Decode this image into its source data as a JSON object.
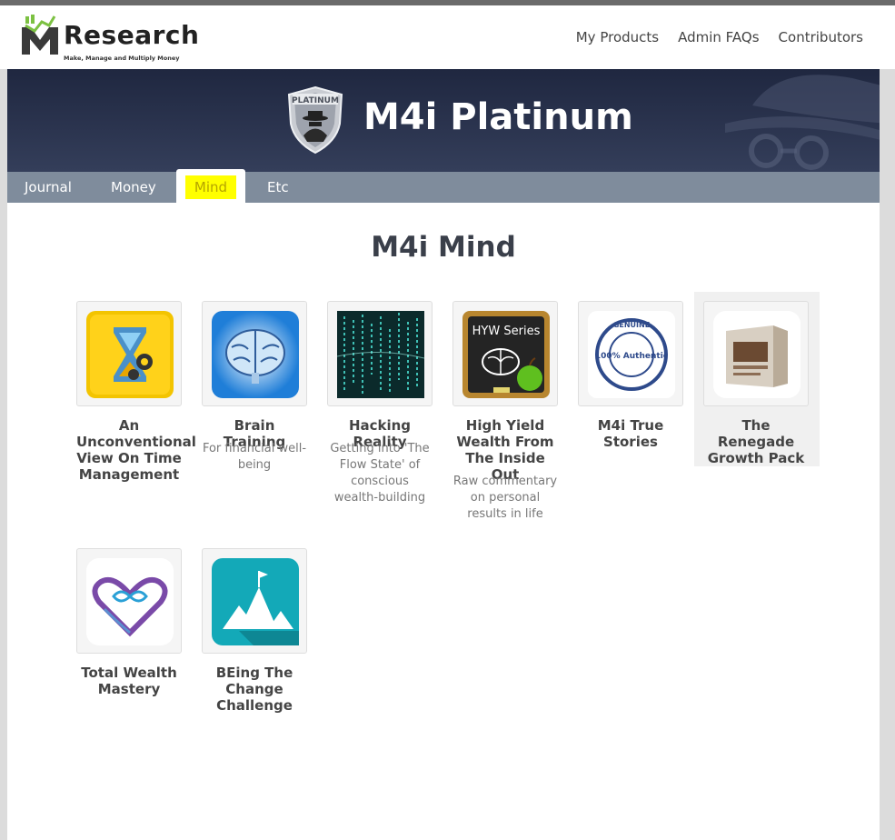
{
  "brand": {
    "name": "Research",
    "tagline": "Make, Manage and Multiply Money"
  },
  "topnav": [
    "My Products",
    "Admin FAQs",
    "Contributors"
  ],
  "banner": {
    "title": "M4i Platinum",
    "badge": "PLATINUM"
  },
  "tabs": [
    "Journal",
    "Money",
    "Mind",
    "Etc"
  ],
  "active_tab": "Mind",
  "section": {
    "title": "M4i Mind"
  },
  "products": [
    {
      "name": "An Unconventional View On Time Management",
      "desc": "",
      "icon": "hourglass-icon"
    },
    {
      "name": "Brain Training",
      "desc": "For financial well-being",
      "icon": "brain-icon"
    },
    {
      "name": "Hacking Reality",
      "desc": "Getting into 'The Flow State' of conscious wealth-building",
      "icon": "matrix-code-icon"
    },
    {
      "name": "High Yield Wealth From The Inside Out",
      "desc": "Raw commentary on personal results in life",
      "icon": "hyw-series-chalkboard-icon",
      "label": "HYW Series"
    },
    {
      "name": "M4i True Stories",
      "desc": "",
      "icon": "genuine-stamp-icon",
      "label": "100% Authentic",
      "ring": "GENUINE"
    },
    {
      "name": "The Renegade Growth Pack",
      "desc": "",
      "icon": "product-box-icon"
    },
    {
      "name": "Total Wealth Mastery",
      "desc": "",
      "icon": "infinity-heart-icon"
    },
    {
      "name": "BEing The Change Challenge",
      "desc": "",
      "icon": "mountain-flag-icon"
    }
  ],
  "colors": {
    "banner": "#2a3350",
    "tabbar": "#7f8c9c",
    "highlight": "#ffff00"
  }
}
